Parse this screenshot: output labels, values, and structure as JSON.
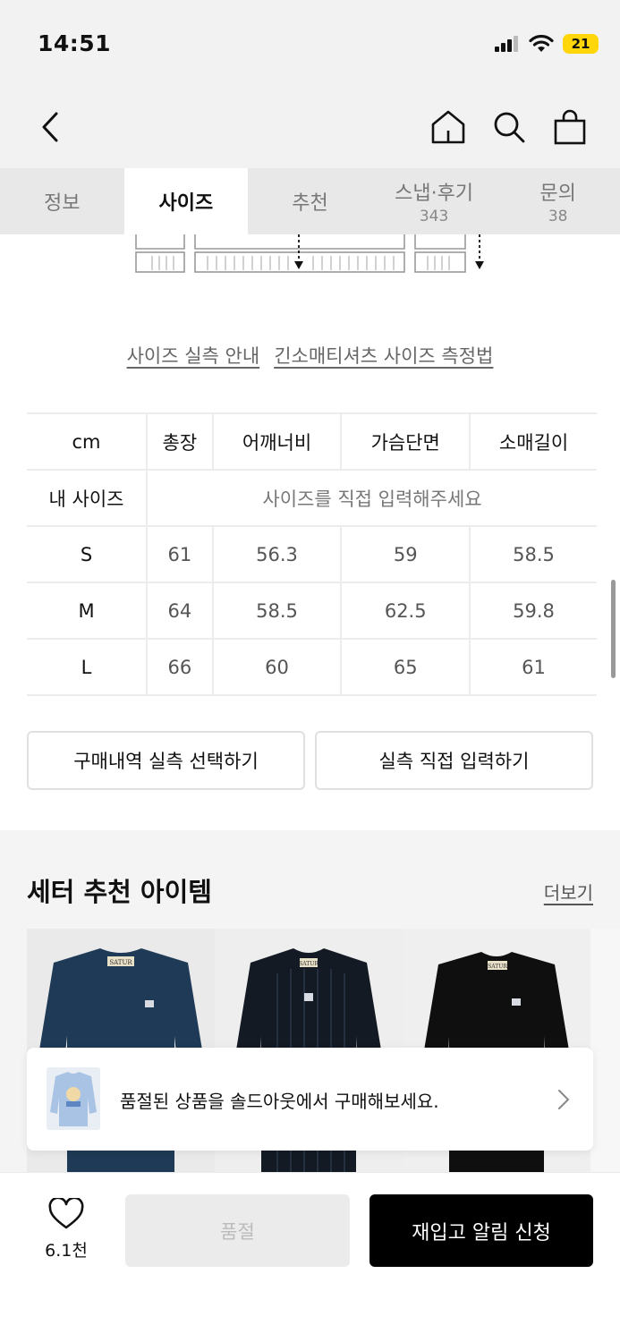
{
  "status_bar": {
    "time": "14:51",
    "battery": "21"
  },
  "tabs": [
    {
      "label": "정보",
      "count": ""
    },
    {
      "label": "사이즈",
      "count": ""
    },
    {
      "label": "추천",
      "count": ""
    },
    {
      "label": "스냅·후기",
      "count": "343"
    },
    {
      "label": "문의",
      "count": "38"
    }
  ],
  "guide_links": {
    "size_guide": "사이즈 실측 안내",
    "measure_method": "긴소매티셔츠 사이즈 측정법"
  },
  "size_table": {
    "unit": "cm",
    "columns": [
      "총장",
      "어깨너비",
      "가슴단면",
      "소매길이"
    ],
    "my_size_label": "내 사이즈",
    "my_size_hint": "사이즈를 직접 입력해주세요",
    "rows": [
      {
        "size": "S",
        "values": [
          "61",
          "56.3",
          "59",
          "58.5"
        ]
      },
      {
        "size": "M",
        "values": [
          "64",
          "58.5",
          "62.5",
          "59.8"
        ]
      },
      {
        "size": "L",
        "values": [
          "66",
          "60",
          "65",
          "61"
        ]
      }
    ]
  },
  "actions": {
    "select_history": "구매내역 실측 선택하기",
    "direct_input": "실측 직접 입력하기"
  },
  "recommend": {
    "title": "세터 추천 아이템",
    "more": "더보기",
    "products": [
      {
        "brand_label": "SATUR",
        "color": "#1f3a56"
      },
      {
        "brand_label": "SATUR",
        "color": "#141a24"
      },
      {
        "brand_label": "SATUR",
        "color": "#0f0f0f"
      }
    ]
  },
  "toast": {
    "text": "품절된 상품을 솔드아웃에서 구매해보세요."
  },
  "bottom": {
    "wish_count": "6.1천",
    "soldout": "품절",
    "restock": "재입고 알림 신청"
  }
}
